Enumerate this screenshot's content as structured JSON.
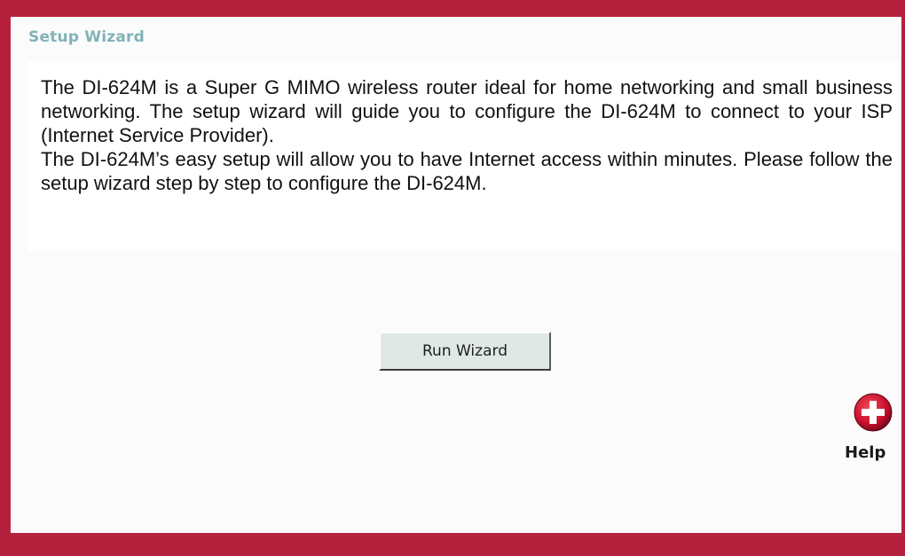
{
  "wizard": {
    "title": "Setup Wizard",
    "description_1": "The DI-624M is a Super G MIMO wireless router ideal for home networking and small business networking. The setup wizard will guide you to configure the DI-624M to connect to your ISP (Internet Service Provider).",
    "description_2": "The DI-624M’s easy setup will allow you to have Internet access within minutes. Please follow the setup wizard step by step to configure the DI-624M.",
    "run_button_label": "Run Wizard"
  },
  "help": {
    "label": "Help",
    "icon": "help-plus-icon"
  },
  "colors": {
    "frame": "#b5213d",
    "title": "#7fb3b8",
    "help_icon": "#c8102e"
  }
}
